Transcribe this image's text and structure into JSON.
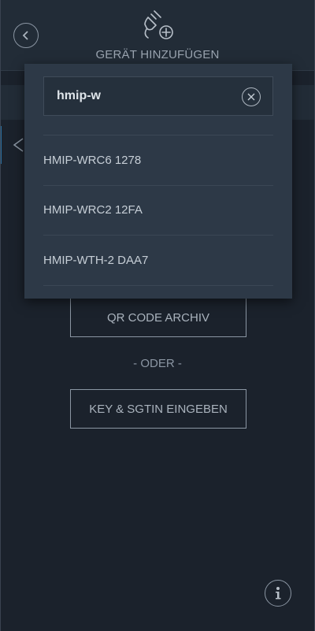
{
  "header": {
    "title": "GERÄT HINZUFÜGEN",
    "back_icon": "back-arrow-circle-icon",
    "device_icon": "plug-add-icon"
  },
  "search": {
    "value": "hmip-w",
    "clear_icon": "clear-circle-icon"
  },
  "results": [
    {
      "label": "HMIP-WRC6 1278"
    },
    {
      "label": "HMIP-WRC2 12FA"
    },
    {
      "label": "HMIP-WTH-2 DAA7"
    }
  ],
  "main": {
    "qr_button": "QR CODE ARCHIV",
    "separator": "- ODER -",
    "key_button": "KEY & SGTIN EINGEBEN"
  },
  "footer": {
    "info_icon": "info-icon"
  },
  "colors": {
    "background": "#1b222c",
    "header": "#222c37",
    "dropdown": "#2d3947",
    "accent": "#2a6fa0"
  }
}
